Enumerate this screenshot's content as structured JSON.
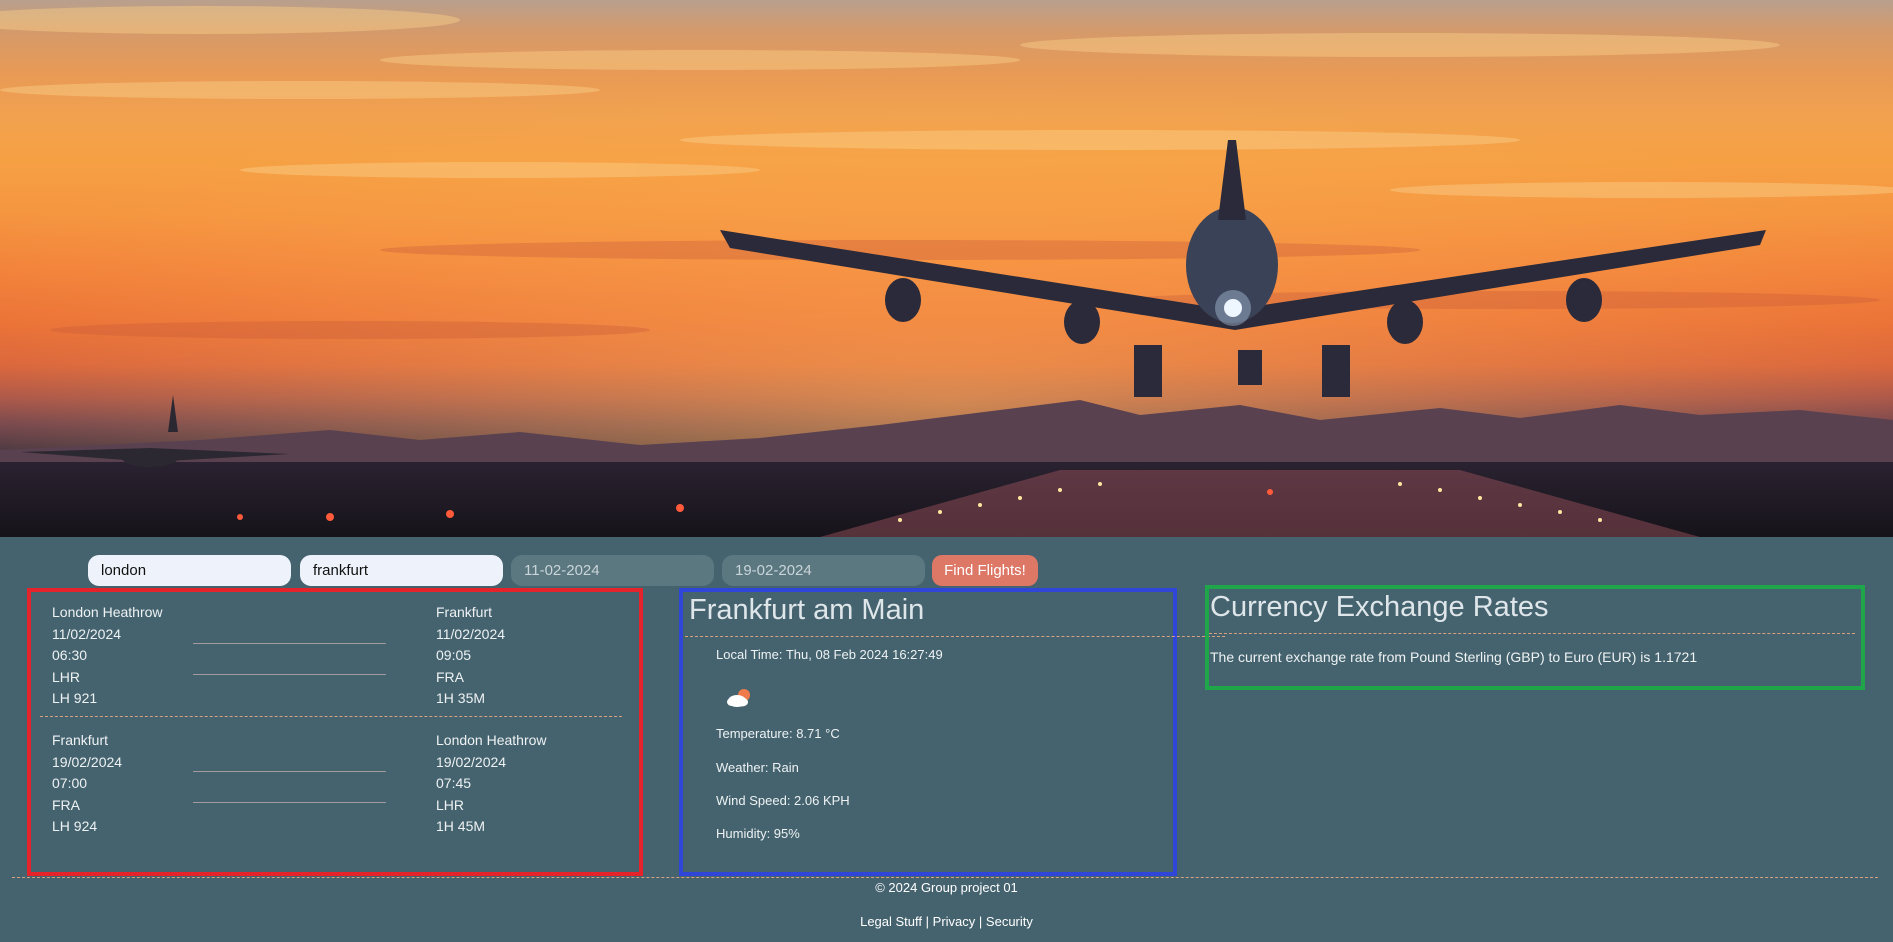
{
  "search": {
    "origin": "london",
    "destination": "frankfurt",
    "depart_date": "11-02-2024",
    "return_date": "19-02-2024",
    "find_label": "Find Flights!"
  },
  "flights": {
    "outbound": {
      "from": {
        "airport": "London Heathrow",
        "date": "11/02/2024",
        "time": "06:30",
        "code": "LHR",
        "flight": "LH 921"
      },
      "to": {
        "airport": "Frankfurt",
        "date": "11/02/2024",
        "time": "09:05",
        "code": "FRA",
        "duration": "1H 35M"
      }
    },
    "inbound": {
      "from": {
        "airport": "Frankfurt",
        "date": "19/02/2024",
        "time": "07:00",
        "code": "FRA",
        "flight": "LH 924"
      },
      "to": {
        "airport": "London Heathrow",
        "date": "19/02/2024",
        "time": "07:45",
        "code": "LHR",
        "duration": "1H 45M"
      }
    }
  },
  "weather": {
    "city": "Frankfurt am Main",
    "local_time": "Local Time: Thu, 08 Feb 2024 16:27:49",
    "icon": "cloud-sun-icon",
    "temperature": "Temperature: 8.71 °C",
    "condition": "Weather: Rain",
    "wind": "Wind Speed: 2.06 KPH",
    "humidity": "Humidity: 95%"
  },
  "currency": {
    "title": "Currency Exchange Rates",
    "text": "The current exchange rate from Pound Sterling (GBP) to Euro (EUR) is 1.1721"
  },
  "footer": {
    "copyright": "© 2024 Group project 01",
    "legal": "Legal Stuff",
    "separator": "|",
    "privacy": "Privacy",
    "security": "Security"
  },
  "colors": {
    "page_bg": "#45636f",
    "button": "#dd7766",
    "flights_border": "#e5232b",
    "weather_border": "#2f46d8",
    "currency_border": "#1fa64a"
  }
}
